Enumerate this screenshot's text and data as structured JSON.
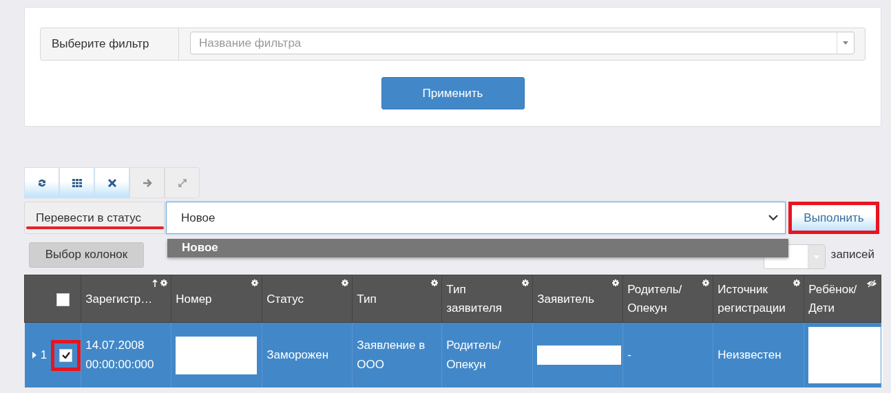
{
  "filter": {
    "label": "Выберите фильтр",
    "placeholder": "Название фильтра",
    "apply": "Применить"
  },
  "toolbar": [
    {
      "kind": "refresh",
      "disabled": false
    },
    {
      "kind": "grid",
      "disabled": false
    },
    {
      "kind": "clear",
      "disabled": false
    },
    {
      "kind": "arrow",
      "disabled": true
    },
    {
      "kind": "expand",
      "disabled": true
    }
  ],
  "status_change": {
    "label": "Перевести в статус",
    "value": "Новое",
    "options": [
      {
        "label": "Новое",
        "selected": true
      }
    ],
    "execute": "Выполнить"
  },
  "columns_button": "Выбор колонок",
  "page_size": {
    "suffix": "записей"
  },
  "table": {
    "select_all_checked": false,
    "columns": [
      {
        "label": "Зарегистр…",
        "sorted": true,
        "kind": "configurable"
      },
      {
        "label": "Номер",
        "sorted": false,
        "kind": "configurable"
      },
      {
        "label": "Статус",
        "sorted": false,
        "kind": "configurable"
      },
      {
        "label": "Тип",
        "sorted": false,
        "kind": "configurable"
      },
      {
        "label": "Тип заявителя",
        "sorted": false,
        "kind": "configurable"
      },
      {
        "label": "Заявитель",
        "sorted": false,
        "kind": "configurable"
      },
      {
        "label": "Родитель/ Опекун",
        "sorted": false,
        "kind": "configurable"
      },
      {
        "label": "Источник регистрации",
        "sorted": false,
        "kind": "configurable"
      },
      {
        "label": "Ребёнок/ Дети",
        "sorted": false,
        "kind": "hideable"
      }
    ],
    "rows": [
      {
        "number": "1",
        "selected": true,
        "checked": true,
        "cells": [
          {
            "kind": "text",
            "text": "14.07.2008 00:00:00:000"
          },
          {
            "kind": "redacted"
          },
          {
            "kind": "text",
            "text": "Заморожен"
          },
          {
            "kind": "text",
            "text": "Заявление в ООО"
          },
          {
            "kind": "text",
            "text": "Родитель/ Опекун"
          },
          {
            "kind": "redacted"
          },
          {
            "kind": "text",
            "text": "-"
          },
          {
            "kind": "text",
            "text": "Неизвестен"
          },
          {
            "kind": "redacted"
          }
        ]
      }
    ]
  }
}
